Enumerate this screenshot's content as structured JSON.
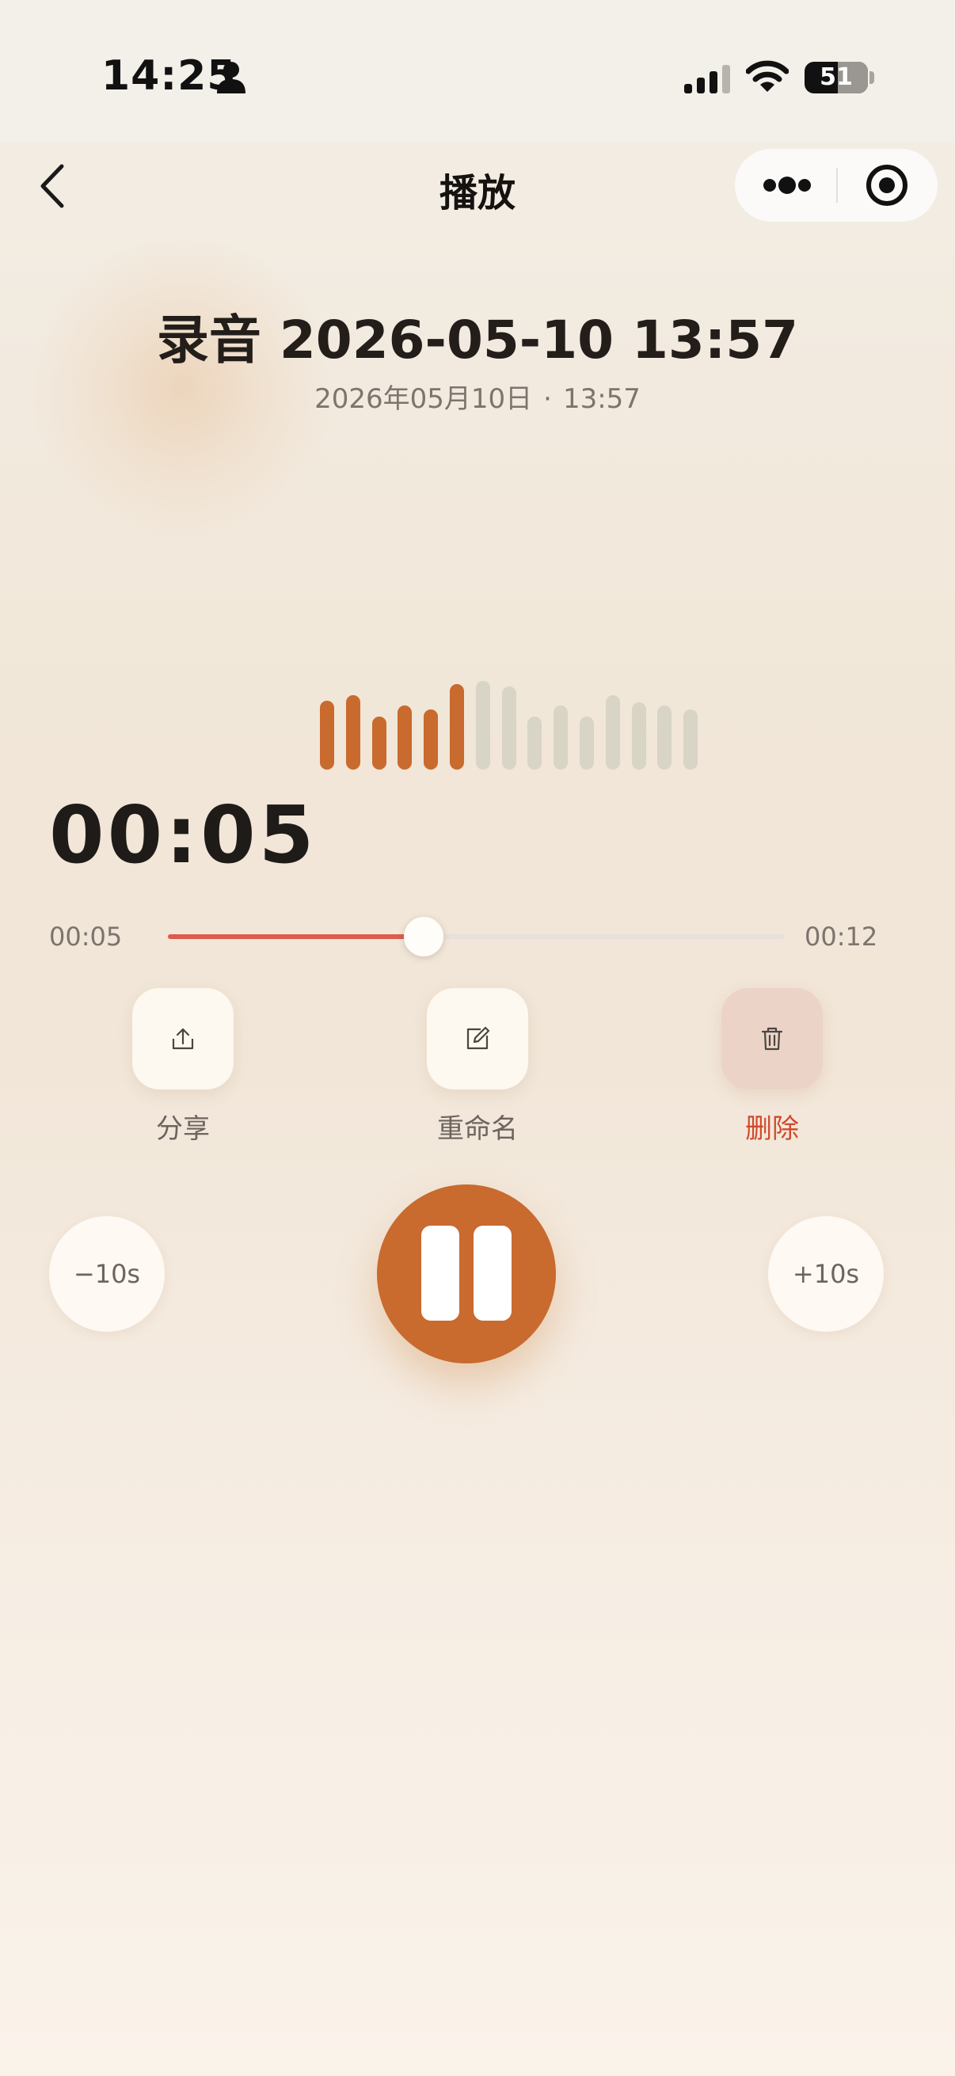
{
  "status_bar": {
    "time": "14:25",
    "battery_level": "51"
  },
  "nav": {
    "title": "播放"
  },
  "recording": {
    "title": "录音 2026-05-10 13:57",
    "date": "2026年05月10日",
    "time": "13:57",
    "separator": "·"
  },
  "waveform": {
    "played_count": 6,
    "levels": [
      0.78,
      0.84,
      0.6,
      0.72,
      0.68,
      0.96,
      1.0,
      0.94,
      0.6,
      0.72,
      0.6,
      0.84,
      0.76,
      0.72,
      0.68
    ]
  },
  "player": {
    "elapsed": "00:05",
    "current": "00:05",
    "total": "00:12",
    "progress": 0.415,
    "state": "playing"
  },
  "actions": [
    {
      "id": "share",
      "label": "分享",
      "icon": "share-icon"
    },
    {
      "id": "rename",
      "label": "重命名",
      "icon": "edit-icon"
    },
    {
      "id": "delete",
      "label": "删除",
      "icon": "trash-icon",
      "color": "#d04a2d"
    }
  ],
  "transport": {
    "rewind_label": "−10s",
    "forward_label": "+10s",
    "accent": "#c96a2e"
  }
}
